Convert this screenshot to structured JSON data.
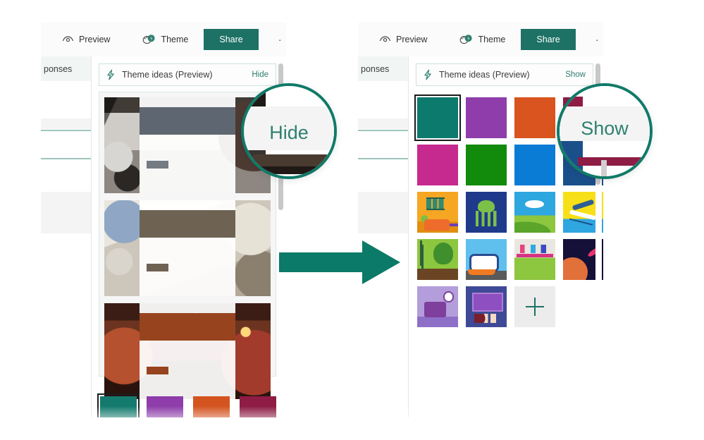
{
  "commandbar": {
    "preview_label": "Preview",
    "preview_icon": "eye-icon",
    "theme_label": "Theme",
    "theme_icon": "theme-palette-icon",
    "share_label": "Share",
    "more_label": "· · ·",
    "share_bg": "#1d7165"
  },
  "navstrip": {
    "responses_label": "ponses"
  },
  "left_panel": {
    "ideas": {
      "icon": "lightning-bolt-icon",
      "title": "Theme ideas (Preview)",
      "action_label": "Hide",
      "action_color": "#2f7d6f"
    },
    "preview_cards": [
      {
        "name": "office-meeting-theme-card",
        "title_color": "#5e6671",
        "chip_color": "#757b83"
      },
      {
        "name": "desk-flatlay-theme-card",
        "title_color": "#6e6253",
        "chip_color": "#6e6253"
      },
      {
        "name": "party-lights-theme-card",
        "title_color": "#97441e",
        "chip_color": "#97441e"
      }
    ],
    "bottom_swatches": [
      {
        "name": "teal-swatch",
        "color": "#157a6e",
        "selected": true
      },
      {
        "name": "purple-swatch",
        "color": "#8e3daa",
        "selected": false
      },
      {
        "name": "orange-swatch",
        "color": "#d4541f",
        "selected": false
      },
      {
        "name": "maroon-swatch",
        "color": "#8e1c45",
        "selected": false
      }
    ],
    "magnifier": {
      "label": "Hide",
      "ring_color": "#0f7a68"
    }
  },
  "right_panel": {
    "ideas": {
      "icon": "lightning-bolt-icon",
      "title": "Theme ideas (Preview)",
      "action_label": "Show",
      "action_color": "#2f7d6f"
    },
    "swatches": [
      {
        "name": "theme-swatch-teal",
        "kind": "color",
        "color": "#0d7a6e",
        "selected": true
      },
      {
        "name": "theme-swatch-purple",
        "kind": "color",
        "color": "#8e3daa",
        "selected": false
      },
      {
        "name": "theme-swatch-orange",
        "kind": "color",
        "color": "#d9541e",
        "selected": false
      },
      {
        "name": "theme-swatch-maroon",
        "kind": "color",
        "color": "#8e1c45",
        "selected": false
      },
      {
        "name": "theme-swatch-magenta",
        "kind": "color",
        "color": "#c72a8e",
        "selected": false
      },
      {
        "name": "theme-swatch-green",
        "kind": "color",
        "color": "#128a0b",
        "selected": false
      },
      {
        "name": "theme-swatch-blue",
        "kind": "color",
        "color": "#0a7cd6",
        "selected": false
      },
      {
        "name": "theme-swatch-navy",
        "kind": "color",
        "color": "#1b4f8a",
        "selected": false
      },
      {
        "name": "theme-swatch-living-room",
        "kind": "image",
        "style": "il-living",
        "selected": false
      },
      {
        "name": "theme-swatch-octopus",
        "kind": "image",
        "style": "il-octopus",
        "selected": false
      },
      {
        "name": "theme-swatch-cloud-hills",
        "kind": "image",
        "style": "il-hill",
        "selected": false
      },
      {
        "name": "theme-swatch-snowboarder",
        "kind": "image",
        "style": "il-snow",
        "selected": false
      },
      {
        "name": "theme-swatch-park-bench",
        "kind": "image",
        "style": "il-park",
        "selected": false
      },
      {
        "name": "theme-swatch-food-truck",
        "kind": "image",
        "style": "il-bus",
        "selected": false
      },
      {
        "name": "theme-swatch-science-lab",
        "kind": "image",
        "style": "il-lab",
        "selected": false
      },
      {
        "name": "theme-swatch-outer-space",
        "kind": "image",
        "style": "il-space",
        "selected": false
      },
      {
        "name": "theme-swatch-desk-clock",
        "kind": "image",
        "style": "il-desk",
        "selected": false
      },
      {
        "name": "theme-swatch-computer-desk",
        "kind": "image",
        "style": "il-monitor",
        "selected": false
      },
      {
        "name": "theme-swatch-add-custom",
        "kind": "add",
        "icon": "plus-icon",
        "selected": false
      }
    ],
    "magnifier": {
      "label": "Show",
      "ring_color": "#0f7a68"
    }
  },
  "arrow": {
    "name": "flow-arrow",
    "color": "#0b7a68",
    "direction": "right"
  }
}
